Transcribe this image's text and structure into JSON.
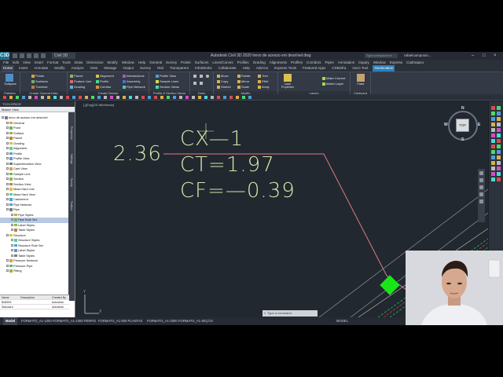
{
  "app": {
    "title": "Autodesk Civil 3D 2020   trevo de acesso em desnível.dwg",
    "logo": "C3D",
    "workspace": "Civil 3D",
    "search_placeholder": "Type a keyword or phrase",
    "user": "rafaelcamposm...",
    "menus": [
      "File",
      "Edit",
      "View",
      "Insert",
      "Format",
      "Tools",
      "Draw",
      "Dimension",
      "Modify",
      "Window",
      "Help"
    ],
    "menus_right": [
      "General",
      "Survey",
      "Points",
      "Surfaces",
      "Lines/Curves",
      "Profiles",
      "Grading",
      "Alignments",
      "Profiles",
      "Corridors",
      "Pipes",
      "Annotation",
      "Inquiry",
      "Window",
      "Express",
      "Cadmapeo"
    ]
  },
  "tabs": [
    "Home",
    "Insert",
    "Annotate",
    "Modify",
    "Analyze",
    "View",
    "Manage",
    "Output",
    "Survey",
    "Rail",
    "Transparent",
    "InfraWorks",
    "Collaborate",
    "Help",
    "Add-ins",
    "Express Tools",
    "Featured Apps",
    "CSBinfra",
    "sncC-Tool",
    "Geolocation"
  ],
  "active_tab": "Home",
  "highlight_tab": "Geolocation",
  "ribbon": {
    "panels": [
      {
        "title": "Palettes",
        "buttons": [
          "Toolspace"
        ]
      },
      {
        "title": "Create Ground Data",
        "buttons": [
          "Points",
          "Surfaces",
          "Traverse"
        ]
      },
      {
        "title": "Create Design",
        "buttons": [
          "Parcel",
          "Feature Line",
          "Grading",
          "Alignment",
          "Profile",
          "Corridor",
          "Intersections",
          "Assembly",
          "Pipe Network"
        ]
      },
      {
        "title": "Profile & Section Views",
        "buttons": [
          "Profile View",
          "Sample Lines",
          "Section Views"
        ]
      },
      {
        "title": "Draw",
        "buttons": []
      },
      {
        "title": "Modify",
        "buttons": [
          "Move",
          "Copy",
          "Stretch",
          "Rotate",
          "Mirror",
          "Scale",
          "Trim",
          "Fillet",
          "Array"
        ]
      },
      {
        "title": "Layers",
        "buttons": [
          "Layer Properties",
          "Make Current",
          "Match Layer"
        ]
      },
      {
        "title": "Clipboard",
        "buttons": [
          "Paste"
        ]
      }
    ]
  },
  "toolspace": {
    "header": "TOOLSPACE",
    "view": "Master View",
    "side_tabs": [
      "Prospector",
      "Settings",
      "Survey",
      "Toolbox"
    ],
    "tree": [
      {
        "label": "trevo de acesso em desnível",
        "level": 0,
        "expanded": true
      },
      {
        "label": "General",
        "level": 1
      },
      {
        "label": "Point",
        "level": 1
      },
      {
        "label": "Surface",
        "level": 1
      },
      {
        "label": "Parcel",
        "level": 1
      },
      {
        "label": "Grading",
        "level": 1
      },
      {
        "label": "Alignment",
        "level": 1
      },
      {
        "label": "Profile",
        "level": 1
      },
      {
        "label": "Profile View",
        "level": 1
      },
      {
        "label": "Superelevation View",
        "level": 1
      },
      {
        "label": "Cant View",
        "level": 1
      },
      {
        "label": "Sample Line",
        "level": 1
      },
      {
        "label": "Section",
        "level": 1
      },
      {
        "label": "Section View",
        "level": 1
      },
      {
        "label": "Mass Haul Line",
        "level": 1
      },
      {
        "label": "Mass Haul View",
        "level": 1
      },
      {
        "label": "Catchment",
        "level": 1
      },
      {
        "label": "Pipe Network",
        "level": 1
      },
      {
        "label": "Pipe",
        "level": 1,
        "expanded": true
      },
      {
        "label": "Pipe Styles",
        "level": 2
      },
      {
        "label": "Pipe Rule Set",
        "level": 2,
        "selected": true
      },
      {
        "label": "Label Styles",
        "level": 2
      },
      {
        "label": "Table Styles",
        "level": 2
      },
      {
        "label": "Structure",
        "level": 1,
        "expanded": true
      },
      {
        "label": "Structure Styles",
        "level": 2
      },
      {
        "label": "Structure Rule Set",
        "level": 2
      },
      {
        "label": "Label Styles",
        "level": 2
      },
      {
        "label": "Table Styles",
        "level": 2
      },
      {
        "label": "Pressure Network",
        "level": 1
      },
      {
        "label": "Pressure Pipe",
        "level": 1
      },
      {
        "label": "Fitting",
        "level": 1
      }
    ],
    "table": {
      "columns": [
        "Name",
        "Description",
        "Created By"
      ],
      "rows": [
        [
          "B08993",
          "",
          "Autodesk"
        ],
        [
          "Standard",
          "",
          "Autodesk"
        ]
      ]
    }
  },
  "drawing": {
    "view_label": "[-][Top][2D Wireframe]",
    "texts": {
      "value_left": "2.36",
      "cx": "CX—1",
      "ct": "CT=1.97",
      "cf": "CF=—0.39"
    },
    "viewcube": {
      "face": "TOP",
      "north": "N",
      "south": "S",
      "east": "E",
      "west": "W",
      "wcs": "WCS"
    },
    "axis": {
      "x": "X",
      "y": "Y"
    }
  },
  "command_line": {
    "placeholder": "Type a command"
  },
  "layout_tabs": [
    "Model",
    "FORMATO_A1-1000",
    "FORMATO_A1-1000 PERFIS",
    "FORMATO_A1-500 PLANTAS",
    "FORMATO_A1-2000",
    "FORMATO_A1-SEÇÃO"
  ],
  "active_layout": "Model",
  "status_text": "MODEL",
  "colors": {
    "cad_text": "#d8e8a8",
    "canvas": "#212830",
    "road_edge": "#e07888",
    "grip": "#19e619",
    "accent_tab": "#2a7fb8"
  }
}
